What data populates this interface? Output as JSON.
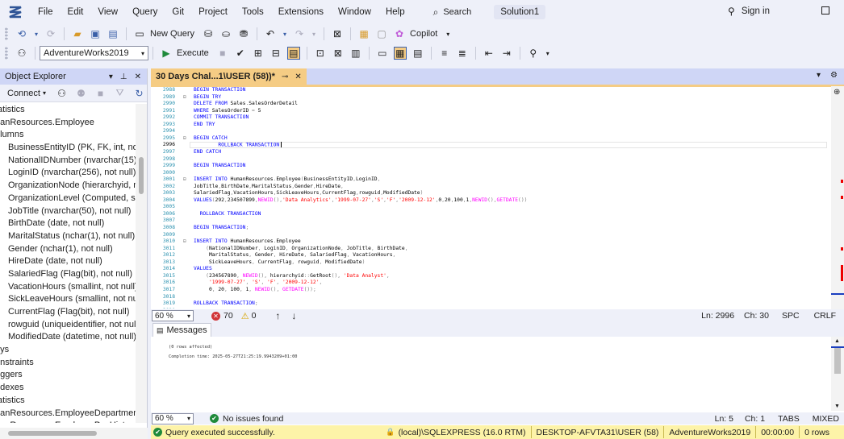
{
  "menu": [
    "File",
    "Edit",
    "View",
    "Query",
    "Git",
    "Project",
    "Tools",
    "Extensions",
    "Window",
    "Help"
  ],
  "search_label": "Search",
  "solution": "Solution1",
  "signin": "Sign in",
  "toolbar1": {
    "new_query": "New Query",
    "copilot": "Copilot"
  },
  "toolbar2": {
    "database": "AdventureWorks2019",
    "execute": "Execute"
  },
  "object_explorer": {
    "title": "Object Explorer",
    "connect": "Connect",
    "items": [
      {
        "text": "tatistics",
        "level": 1
      },
      {
        "text": "nanResources.Employee",
        "level": 1
      },
      {
        "text": "olumns",
        "level": 1
      },
      {
        "text": "BusinessEntityID (PK, FK, int, not nu",
        "level": 2
      },
      {
        "text": "NationalIDNumber (nvarchar(15), n",
        "level": 2
      },
      {
        "text": "LoginID (nvarchar(256), not null)",
        "level": 2
      },
      {
        "text": "OrganizationNode (hierarchyid, nul",
        "level": 2
      },
      {
        "text": "OrganizationLevel (Computed, sma",
        "level": 2
      },
      {
        "text": "JobTitle (nvarchar(50), not null)",
        "level": 2
      },
      {
        "text": "BirthDate (date, not null)",
        "level": 2
      },
      {
        "text": "MaritalStatus (nchar(1), not null)",
        "level": 2
      },
      {
        "text": "Gender (nchar(1), not null)",
        "level": 2
      },
      {
        "text": "HireDate (date, not null)",
        "level": 2
      },
      {
        "text": "SalariedFlag (Flag(bit), not null)",
        "level": 2
      },
      {
        "text": "VacationHours (smallint, not null)",
        "level": 2
      },
      {
        "text": "SickLeaveHours (smallint, not null)",
        "level": 2
      },
      {
        "text": "CurrentFlag (Flag(bit), not null)",
        "level": 2
      },
      {
        "text": "rowguid (uniqueidentifier, not null)",
        "level": 2
      },
      {
        "text": "ModifiedDate (datetime, not null)",
        "level": 2
      },
      {
        "text": "eys",
        "level": 1
      },
      {
        "text": "onstraints",
        "level": 1
      },
      {
        "text": "riggers",
        "level": 1
      },
      {
        "text": "ndexes",
        "level": 1
      },
      {
        "text": "tatistics",
        "level": 1
      },
      {
        "text": "nanResources.EmployeeDepartment",
        "level": 1
      },
      {
        "text": "nanResources.EmployeePayHistory",
        "level": 1
      }
    ]
  },
  "editor": {
    "tab_title": "30 Days Chal...1\\USER (58))*",
    "lines": [
      {
        "n": "2988",
        "segs": [
          [
            "kw",
            "BEGIN TRANSACTION"
          ]
        ]
      },
      {
        "n": "2989",
        "fold": "⊟",
        "segs": [
          [
            "kw",
            "BEGIN TRY"
          ]
        ]
      },
      {
        "n": "2990",
        "segs": [
          [
            "kw",
            "DELETE FROM "
          ],
          [
            "plain",
            "Sales"
          ],
          [
            "gr",
            "."
          ],
          [
            "plain",
            "SalesOrderDetail"
          ]
        ]
      },
      {
        "n": "2991",
        "segs": [
          [
            "kw",
            "WHERE "
          ],
          [
            "plain",
            "SalesOrderID "
          ],
          [
            "gr",
            "= "
          ],
          [
            "plain",
            "5"
          ]
        ]
      },
      {
        "n": "2992",
        "segs": [
          [
            "kw",
            "COMMIT TRANSACTION"
          ]
        ]
      },
      {
        "n": "2993",
        "segs": [
          [
            "kw",
            "END TRY"
          ]
        ]
      },
      {
        "n": "2994",
        "segs": []
      },
      {
        "n": "2995",
        "fold": "⊟",
        "segs": [
          [
            "kw",
            "BEGIN CATCH"
          ]
        ]
      },
      {
        "n": "2996",
        "current": true,
        "segs": [
          [
            "plain",
            "        "
          ],
          [
            "kw",
            "ROLLBACK TRANSACTION"
          ]
        ]
      },
      {
        "n": "2997",
        "segs": [
          [
            "kw",
            "END CATCH"
          ]
        ]
      },
      {
        "n": "2998",
        "segs": []
      },
      {
        "n": "2999",
        "segs": [
          [
            "kw",
            "BEGIN TRANSACTION"
          ]
        ]
      },
      {
        "n": "3000",
        "segs": []
      },
      {
        "n": "3001",
        "fold": "⊟",
        "segs": [
          [
            "kw",
            "INSERT INTO "
          ],
          [
            "plain",
            "HumanResources"
          ],
          [
            "gr",
            "."
          ],
          [
            "plain",
            "Employee"
          ],
          [
            "gr",
            "("
          ],
          [
            "plain",
            "BusinessEntityID"
          ],
          [
            "gr",
            ","
          ],
          [
            "plain",
            "LoginID"
          ],
          [
            "gr",
            ","
          ]
        ]
      },
      {
        "n": "3002",
        "segs": [
          [
            "plain",
            "JobTitle"
          ],
          [
            "gr",
            ","
          ],
          [
            "plain",
            "BirthDate"
          ],
          [
            "gr",
            ","
          ],
          [
            "plain",
            "MaritalStatus"
          ],
          [
            "gr",
            ","
          ],
          [
            "plain",
            "Gender"
          ],
          [
            "gr",
            ","
          ],
          [
            "plain",
            "HireDate"
          ],
          [
            "gr",
            ","
          ]
        ]
      },
      {
        "n": "3003",
        "segs": [
          [
            "plain",
            "SalariedFlag"
          ],
          [
            "gr",
            ","
          ],
          [
            "plain",
            "VacationHours"
          ],
          [
            "gr",
            ","
          ],
          [
            "plain",
            "SickLeaveHours"
          ],
          [
            "gr",
            ","
          ],
          [
            "plain",
            "CurrentFlag"
          ],
          [
            "gr",
            ","
          ],
          [
            "plain",
            "rowguid"
          ],
          [
            "gr",
            ","
          ],
          [
            "plain",
            "ModifiedDate"
          ],
          [
            "gr",
            ")"
          ]
        ]
      },
      {
        "n": "3004",
        "segs": [
          [
            "kw",
            "VALUES"
          ],
          [
            "gr",
            "("
          ],
          [
            "plain",
            "292"
          ],
          [
            "gr",
            ","
          ],
          [
            "plain",
            "234507899"
          ],
          [
            "gr",
            ","
          ],
          [
            "fn",
            "NEWID"
          ],
          [
            "gr",
            "(),"
          ],
          [
            "str",
            "'Data Analytics'"
          ],
          [
            "gr",
            ","
          ],
          [
            "str",
            "'1999-07-27'"
          ],
          [
            "gr",
            ","
          ],
          [
            "str",
            "'S'"
          ],
          [
            "gr",
            ","
          ],
          [
            "str",
            "'F'"
          ],
          [
            "gr",
            ","
          ],
          [
            "str",
            "'2009-12-12'"
          ],
          [
            "gr",
            ","
          ],
          [
            "plain",
            "0"
          ],
          [
            "gr",
            ","
          ],
          [
            "plain",
            "20"
          ],
          [
            "gr",
            ","
          ],
          [
            "plain",
            "100"
          ],
          [
            "gr",
            ","
          ],
          [
            "plain",
            "1"
          ],
          [
            "gr",
            ","
          ],
          [
            "fn",
            "NEWID"
          ],
          [
            "gr",
            "(),"
          ],
          [
            "fn",
            "GETDATE"
          ],
          [
            "gr",
            "())"
          ]
        ]
      },
      {
        "n": "3005",
        "segs": []
      },
      {
        "n": "3006",
        "segs": [
          [
            "plain",
            "  "
          ],
          [
            "kw",
            "ROLLBACK TRANSACTION"
          ]
        ]
      },
      {
        "n": "3007",
        "segs": []
      },
      {
        "n": "3008",
        "segs": [
          [
            "kw",
            "BEGIN TRANSACTION"
          ],
          [
            "gr",
            ";"
          ]
        ]
      },
      {
        "n": "3009",
        "segs": []
      },
      {
        "n": "3010",
        "fold": "⊟",
        "segs": [
          [
            "kw",
            "INSERT INTO "
          ],
          [
            "plain",
            "HumanResources"
          ],
          [
            "gr",
            "."
          ],
          [
            "plain",
            "Employee"
          ]
        ]
      },
      {
        "n": "3011",
        "segs": [
          [
            "plain",
            "    "
          ],
          [
            "gr",
            "("
          ],
          [
            "plain",
            "NationalIDNumber"
          ],
          [
            "gr",
            ", "
          ],
          [
            "plain",
            "LoginID"
          ],
          [
            "gr",
            ", "
          ],
          [
            "plain",
            "OrganizationNode"
          ],
          [
            "gr",
            ", "
          ],
          [
            "plain",
            "JobTitle"
          ],
          [
            "gr",
            ", "
          ],
          [
            "plain",
            "BirthDate"
          ],
          [
            "gr",
            ","
          ]
        ]
      },
      {
        "n": "3012",
        "segs": [
          [
            "plain",
            "     MaritalStatus"
          ],
          [
            "gr",
            ", "
          ],
          [
            "plain",
            "Gender"
          ],
          [
            "gr",
            ", "
          ],
          [
            "plain",
            "HireDate"
          ],
          [
            "gr",
            ", "
          ],
          [
            "plain",
            "SalariedFlag"
          ],
          [
            "gr",
            ", "
          ],
          [
            "plain",
            "VacationHours"
          ],
          [
            "gr",
            ","
          ]
        ]
      },
      {
        "n": "3013",
        "segs": [
          [
            "plain",
            "     SickLeaveHours"
          ],
          [
            "gr",
            ", "
          ],
          [
            "plain",
            "CurrentFlag"
          ],
          [
            "gr",
            ", "
          ],
          [
            "plain",
            "rowguid"
          ],
          [
            "gr",
            ", "
          ],
          [
            "plain",
            "ModifiedDate"
          ],
          [
            "gr",
            ")"
          ]
        ]
      },
      {
        "n": "3014",
        "segs": [
          [
            "kw",
            "VALUES"
          ]
        ]
      },
      {
        "n": "3015",
        "segs": [
          [
            "plain",
            "    "
          ],
          [
            "gr",
            "("
          ],
          [
            "plain",
            "234567890"
          ],
          [
            "gr",
            ", "
          ],
          [
            "fn",
            "NEWID"
          ],
          [
            "gr",
            "(), "
          ],
          [
            "plain",
            "hierarchyid"
          ],
          [
            "gr",
            "::"
          ],
          [
            "plain",
            "GetRoot"
          ],
          [
            "gr",
            "(), "
          ],
          [
            "str",
            "'Data Analyst'"
          ],
          [
            "gr",
            ","
          ]
        ]
      },
      {
        "n": "3016",
        "segs": [
          [
            "plain",
            "     "
          ],
          [
            "str",
            "'1999-07-27'"
          ],
          [
            "gr",
            ", "
          ],
          [
            "str",
            "'S'"
          ],
          [
            "gr",
            ", "
          ],
          [
            "str",
            "'F'"
          ],
          [
            "gr",
            ", "
          ],
          [
            "str",
            "'2009-12-12'"
          ],
          [
            "gr",
            ","
          ]
        ]
      },
      {
        "n": "3017",
        "segs": [
          [
            "plain",
            "     0"
          ],
          [
            "gr",
            ", "
          ],
          [
            "plain",
            "20"
          ],
          [
            "gr",
            ", "
          ],
          [
            "plain",
            "100"
          ],
          [
            "gr",
            ", "
          ],
          [
            "plain",
            "1"
          ],
          [
            "gr",
            ", "
          ],
          [
            "fn",
            "NEWID"
          ],
          [
            "gr",
            "(), "
          ],
          [
            "fn",
            "GETDATE"
          ],
          [
            "gr",
            "());"
          ]
        ]
      },
      {
        "n": "3018",
        "segs": []
      },
      {
        "n": "3019",
        "segs": [
          [
            "kw",
            "ROLLBACK TRANSACTION"
          ],
          [
            "gr",
            ";"
          ]
        ]
      },
      {
        "n": "3020",
        "segs": []
      }
    ]
  },
  "editor_status": {
    "zoom": "60 %",
    "errors": "70",
    "warnings": "0",
    "ln": "Ln: 2996",
    "ch": "Ch: 30",
    "spc": "SPC",
    "crlf": "CRLF"
  },
  "messages": {
    "tab": "Messages",
    "lines": [
      "(0 rows affected)",
      "",
      "Completion time: 2025-05-27T21:25:19.9943209+01:00"
    ]
  },
  "results_status": {
    "zoom": "60 %",
    "issues": "No issues found",
    "ln": "Ln: 5",
    "ch": "Ch: 1",
    "tabs": "TABS",
    "mixed": "MIXED"
  },
  "query_status": {
    "message": "Query executed successfully.",
    "server": "(local)\\SQLEXPRESS (16.0 RTM)",
    "user": "DESKTOP-AFVTA31\\USER (58)",
    "db": "AdventureWorks2019",
    "time": "00:00:00",
    "rows": "0 rows"
  },
  "colors": {
    "accent": "#cfd6f6",
    "tab_active": "#f5cc84",
    "status_bar": "#fdf3a8",
    "keyword": "#0000ff",
    "string": "#ff0000",
    "function": "#ff00ff"
  }
}
